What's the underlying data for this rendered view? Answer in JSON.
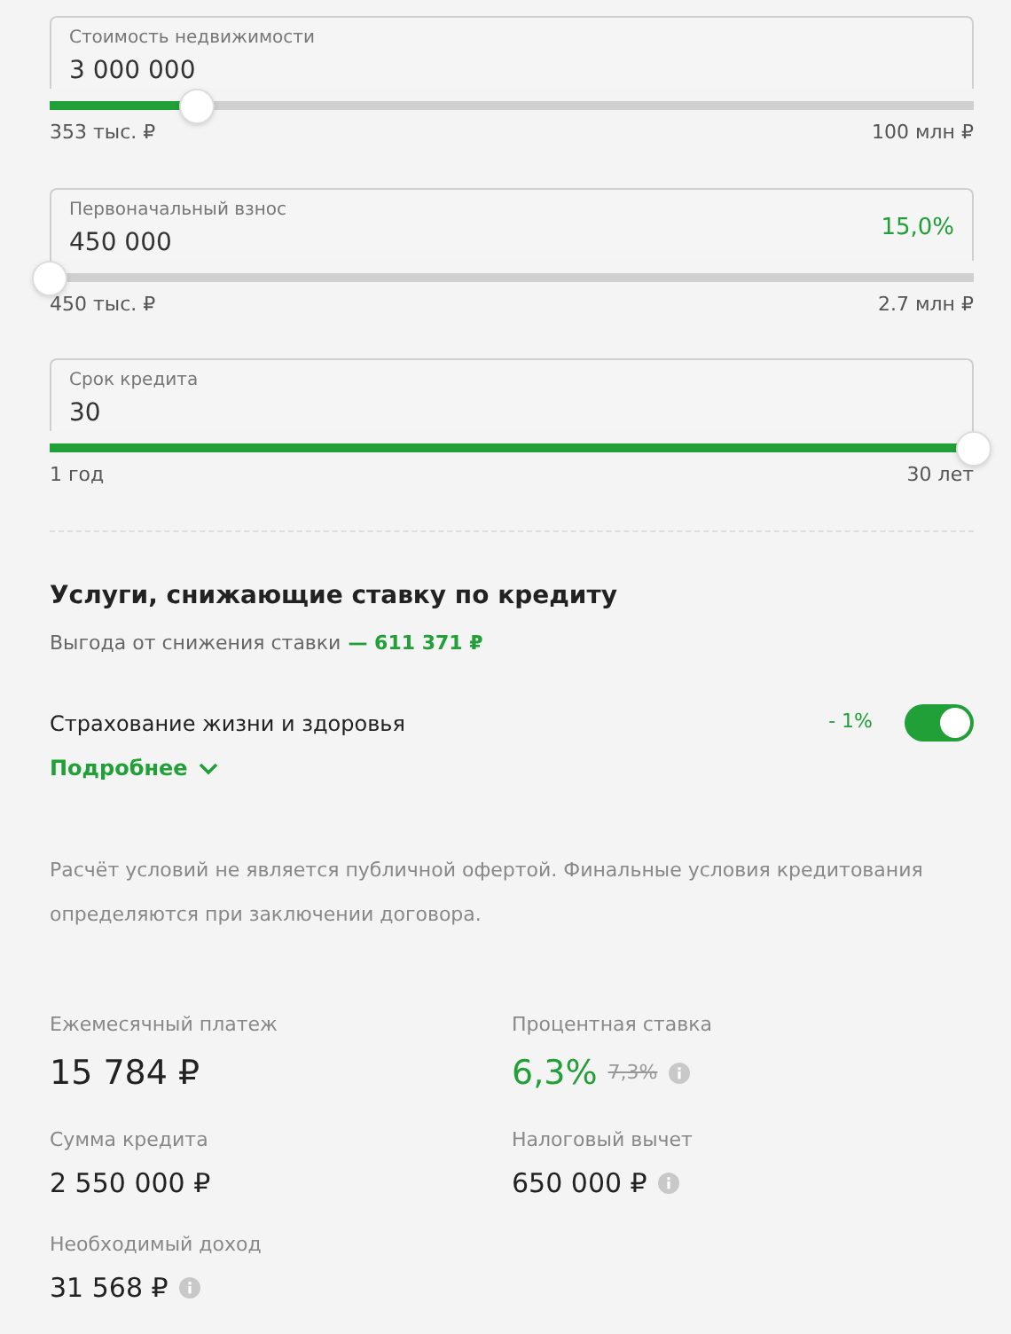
{
  "sliders": [
    {
      "label": "Стоимость недвижимости",
      "value": "3 000 000",
      "min_label": "353 тыс. ₽",
      "max_label": "100 млн ₽",
      "level": 0.16
    },
    {
      "label": "Первоначальный взнос",
      "value": "450 000",
      "percent": "15,0%",
      "min_label": "450 тыс. ₽",
      "max_label": "2.7 млн ₽",
      "level": 0
    },
    {
      "label": "Срок кредита",
      "value": "30",
      "min_label": "1 год",
      "max_label": "30 лет",
      "level": 1
    }
  ],
  "services": {
    "title": "Услуги, снижающие ставку по кредиту",
    "benefit_label": "Выгода от снижения ставки",
    "benefit_value": "— 611 371 ₽",
    "items": [
      {
        "name": "Страхование жизни и здоровья",
        "discount": "- 1%",
        "on": true,
        "more_link": "Подробнее",
        "expanded": false
      }
    ]
  },
  "disclaimer": "Расчёт условий не является публичной офертой. Финальные условия кредитования определяются при заключении договора.",
  "results": [
    {
      "label": "Ежемесячный платеж",
      "value": "15 784 ₽",
      "kind": "large",
      "accent": false,
      "info": false
    },
    {
      "label": "Процентная ставка",
      "value": "6,3%",
      "old_value": "7,3%",
      "kind": "large",
      "accent": true,
      "info": true
    },
    {
      "label": "Сумма кредита",
      "value": "2 550 000 ₽",
      "kind": "normal",
      "accent": false,
      "info": false
    },
    {
      "label": "Налоговый вычет",
      "value": "650 000 ₽",
      "kind": "normal",
      "accent": false,
      "info": true
    },
    {
      "label": "Необходимый доход",
      "value": "31 568 ₽",
      "kind": "normal",
      "accent": false,
      "info": true
    }
  ]
}
